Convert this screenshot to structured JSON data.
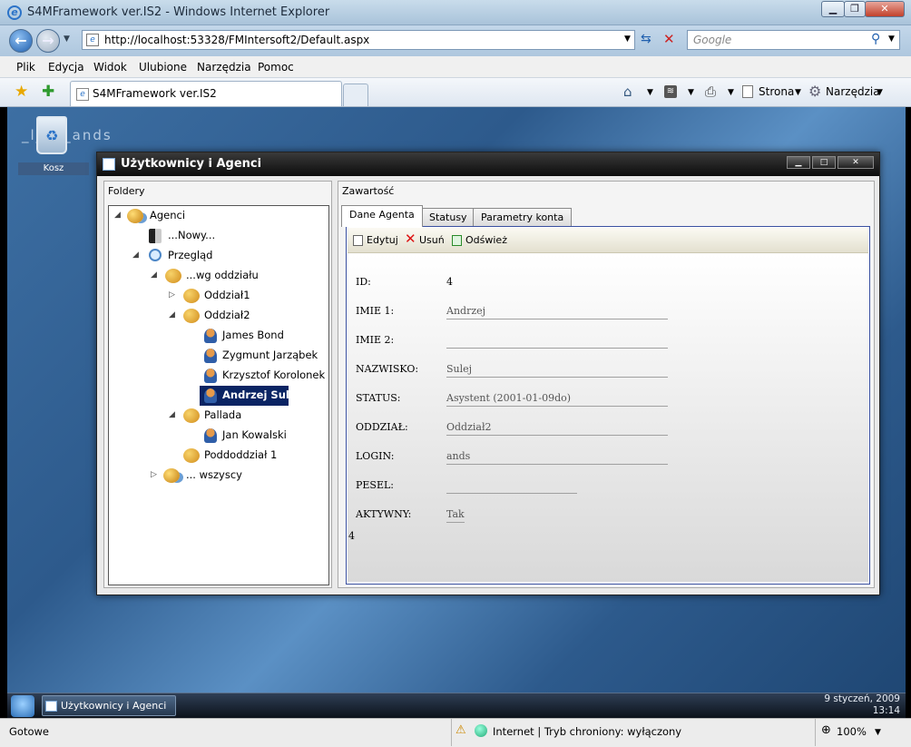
{
  "browser": {
    "title": "S4MFramework ver.IS2 - Windows Internet Explorer",
    "url": "http://localhost:53328/FMIntersoft2/Default.aspx",
    "search_placeholder": "Google",
    "menu": [
      "Plik",
      "Edycja",
      "Widok",
      "Ulubione",
      "Narzędzia",
      "Pomoc"
    ],
    "tab_title": "S4MFramework ver.IS2",
    "commands": {
      "page": "Strona",
      "tools": "Narzędzia"
    }
  },
  "desktop": {
    "background_text": "_l__n_ands",
    "trash_label": "Kosz"
  },
  "app_window": {
    "title": "Użytkownicy i Agenci",
    "left_pane_title": "Foldery",
    "right_pane_title": "Zawartość",
    "tree": [
      {
        "label": "Agenci",
        "icon": "agents-group-icon"
      },
      {
        "label": "...Nowy...",
        "icon": "new-agent-icon"
      },
      {
        "label": "Przegląd",
        "icon": "search-icon"
      },
      {
        "label": "...wg oddziału",
        "icon": "group-icon"
      },
      {
        "label": "Oddział1",
        "icon": "group-icon"
      },
      {
        "label": "Oddział2",
        "icon": "group-icon"
      },
      {
        "label": "James Bond",
        "icon": "user-icon"
      },
      {
        "label": "Zygmunt Jarząbek",
        "icon": "user-icon"
      },
      {
        "label": "Krzysztof Korolonek",
        "icon": "user-icon"
      },
      {
        "label": "Andrzej Sulej",
        "icon": "user-icon",
        "selected": true
      },
      {
        "label": "Pallada",
        "icon": "group-icon"
      },
      {
        "label": "Jan Kowalski",
        "icon": "user-icon"
      },
      {
        "label": "Poddoddział 1",
        "icon": "group-icon"
      },
      {
        "label": "... wszyscy",
        "icon": "agents-group-icon"
      }
    ],
    "tabs": [
      "Dane Agenta",
      "Statusy",
      "Parametry konta"
    ],
    "toolbar": {
      "edit": "Edytuj",
      "delete": "Usuń",
      "refresh": "Odśwież"
    },
    "form": [
      {
        "label": "ID:",
        "value": "4"
      },
      {
        "label": "IMIE 1:",
        "value": "Andrzej"
      },
      {
        "label": "IMIE 2:",
        "value": ""
      },
      {
        "label": "NAZWISKO:",
        "value": "Sulej"
      },
      {
        "label": "STATUS:",
        "value": "Asystent (2001-01-09do)"
      },
      {
        "label": "ODDZIAŁ:",
        "value": "Oddział2"
      },
      {
        "label": "LOGIN:",
        "value": "ands"
      },
      {
        "label": "PESEL:",
        "value": ""
      },
      {
        "label": "AKTYWNY:",
        "value": "Tak"
      }
    ],
    "footer_value": "4"
  },
  "taskbar": {
    "item": "Użytkownicy i Agenci",
    "date": "9 styczeń, 2009",
    "time": "13:14"
  },
  "status": {
    "left": "Gotowe",
    "zone": "Internet | Tryb chroniony: wyłączony",
    "zoom": "100%"
  }
}
